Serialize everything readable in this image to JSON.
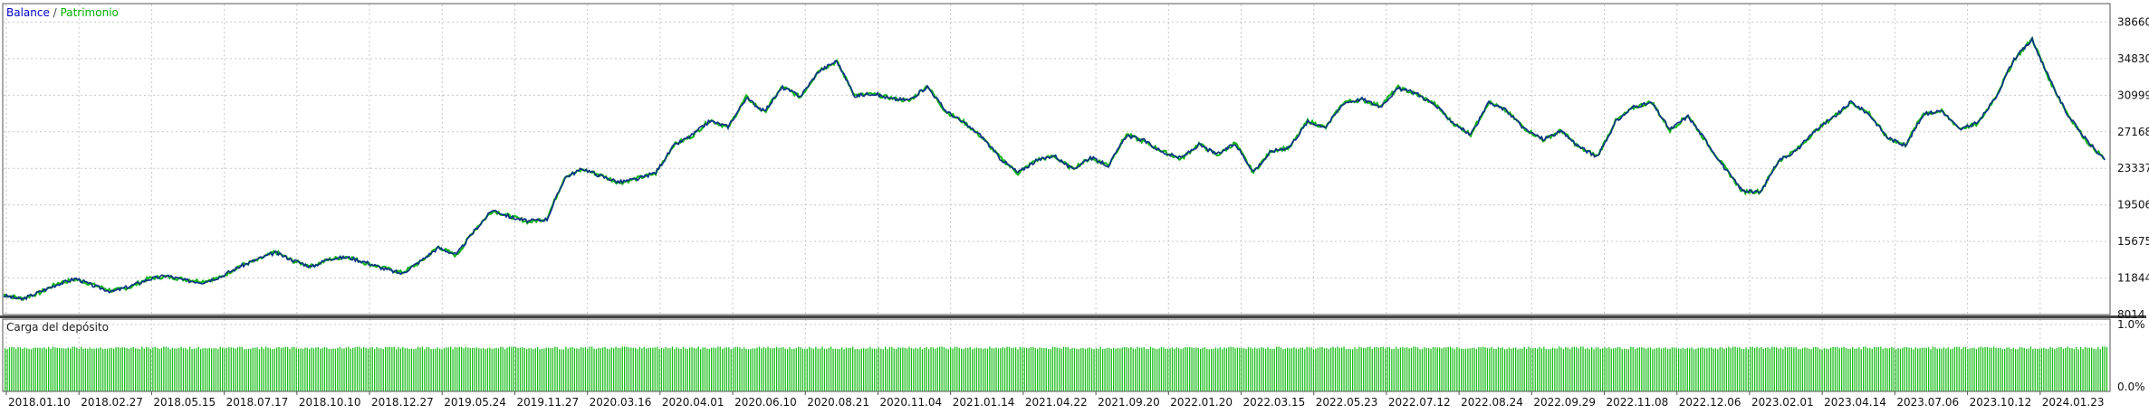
{
  "colors": {
    "balance": "#0a2f86",
    "equity": "#16b51a",
    "load": "#1fbf1f",
    "grid": "#c8c8c8",
    "frame": "#555555",
    "text": "#111111"
  },
  "main_legend": {
    "balance": "Balance",
    "separator": " / ",
    "equity": "Patrimonio"
  },
  "load_legend": "Carga del depósito",
  "chart_data": [
    {
      "type": "line",
      "ylim": [
        8014,
        40500
      ],
      "y_ticks": [
        38660,
        34830,
        30999,
        27168,
        23337,
        19506,
        15675,
        11844,
        8014
      ],
      "y_tick_labels": [
        "38660",
        "34830",
        "30999",
        "27168",
        "23337",
        "19506",
        "15675",
        "11844",
        "8014"
      ],
      "x_ticks": [
        "2018.01.10",
        "2018.02.27",
        "2018.05.15",
        "2018.07.17",
        "2018.10.10",
        "2018.12.27",
        "2019.05.24",
        "2019.11.27",
        "2020.03.16",
        "2020.04.01",
        "2020.06.10",
        "2020.08.21",
        "2020.11.04",
        "2021.01.14",
        "2021.04.22",
        "2021.09.20",
        "2022.01.20",
        "2022.03.15",
        "2022.05.23",
        "2022.07.12",
        "2022.08.24",
        "2022.09.29",
        "2022.11.08",
        "2022.12.06",
        "2023.02.01",
        "2023.04.14",
        "2023.07.06",
        "2023.10.12",
        "2024.01.23"
      ],
      "series": [
        {
          "name": "Balance",
          "values": [
            10000,
            9600,
            10400,
            11200,
            11800,
            11000,
            10400,
            11000,
            11700,
            12100,
            11600,
            11400,
            12000,
            13000,
            13800,
            14500,
            13700,
            13000,
            13900,
            14000,
            13500,
            12800,
            12300,
            13600,
            15000,
            14300,
            16800,
            19000,
            18200,
            17800,
            18000,
            22400,
            23300,
            22500,
            21900,
            22200,
            22900,
            25700,
            26800,
            28300,
            27700,
            30700,
            29300,
            31800,
            30900,
            33500,
            34600,
            30900,
            31200,
            30600,
            30500,
            31900,
            29400,
            28100,
            26700,
            24400,
            22900,
            24100,
            24700,
            23200,
            24500,
            23600,
            26800,
            26200,
            25000,
            24400,
            25800,
            24800,
            25900,
            23000,
            25100,
            25600,
            28200,
            27700,
            30200,
            30600,
            29800,
            31700,
            31200,
            30000,
            28200,
            26800,
            30200,
            29400,
            27400,
            26400,
            27200,
            25600,
            24500,
            28200,
            29800,
            30200,
            27400,
            28800,
            26200,
            23400,
            21000,
            20800,
            24200,
            25200,
            27300,
            28600,
            30300,
            29000,
            26600,
            25700,
            29000,
            29400,
            27400,
            28100,
            30800,
            34800,
            36800,
            32500,
            28800,
            26300,
            24200
          ]
        },
        {
          "name": "Patrimonio",
          "values": [
            10100,
            9700,
            10300,
            11300,
            11700,
            11100,
            10500,
            10900,
            11800,
            12000,
            11700,
            11500,
            11900,
            13100,
            13700,
            14600,
            13600,
            13100,
            13800,
            14100,
            13400,
            12900,
            12400,
            13500,
            15100,
            14200,
            16900,
            18900,
            18300,
            17700,
            18100,
            22500,
            23200,
            22600,
            21800,
            22300,
            22800,
            25800,
            26700,
            28400,
            27600,
            30800,
            29200,
            31900,
            30800,
            33600,
            34500,
            31000,
            31100,
            30700,
            30400,
            32000,
            29300,
            28200,
            26600,
            24500,
            22800,
            24200,
            24600,
            23300,
            24400,
            23700,
            26900,
            26100,
            25100,
            24300,
            25900,
            24700,
            26000,
            22900,
            25200,
            25500,
            28300,
            27600,
            30300,
            30500,
            29900,
            31800,
            31100,
            30100,
            28100,
            26900,
            30300,
            29300,
            27500,
            26300,
            27300,
            25500,
            24600,
            28300,
            29700,
            30300,
            27300,
            28900,
            26100,
            23500,
            20900,
            20900,
            24100,
            25300,
            27200,
            28700,
            30200,
            29100,
            26500,
            25800,
            29100,
            29300,
            27500,
            28000,
            30900,
            34700,
            36900,
            32400,
            28900,
            26200,
            24300
          ]
        }
      ]
    },
    {
      "type": "bar",
      "ylim": [
        0,
        1.0
      ],
      "y_tick_labels": [
        "1.0%",
        "0.0%"
      ],
      "series": [
        {
          "name": "Carga del depósito",
          "level": 0.62
        }
      ]
    }
  ]
}
